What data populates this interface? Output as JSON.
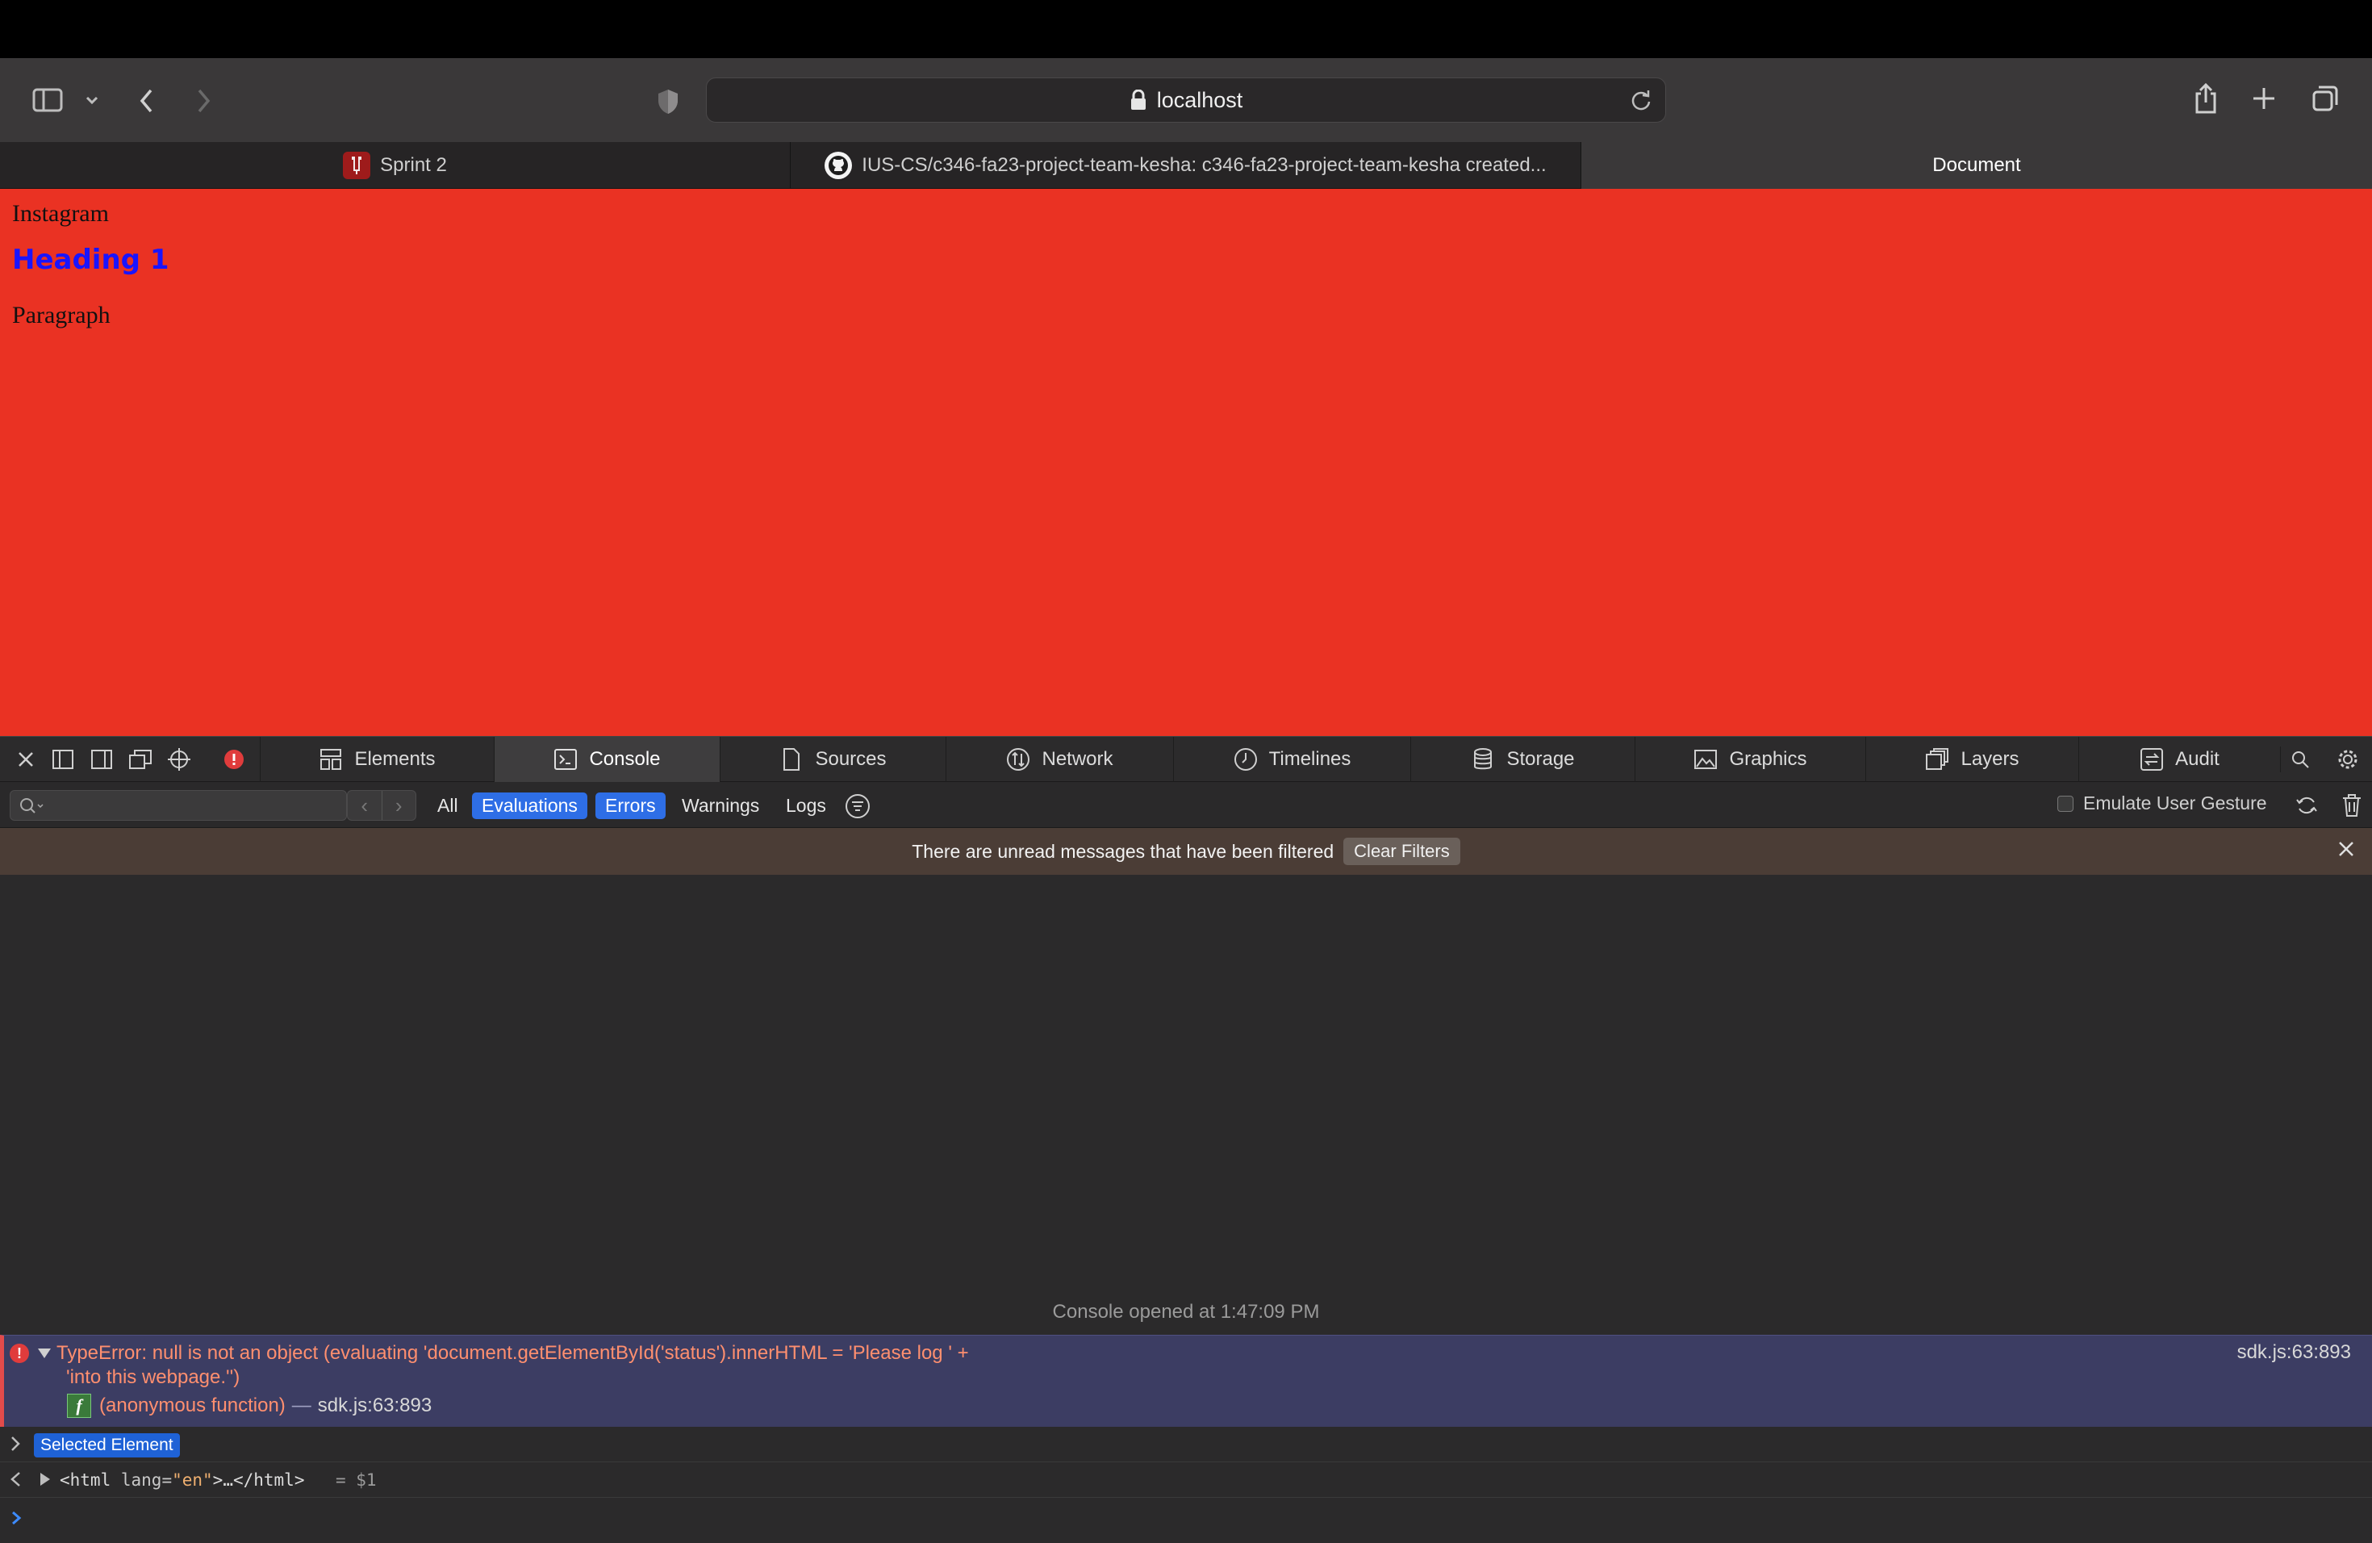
{
  "browser": {
    "address": "localhost",
    "tabs": [
      {
        "title": "Sprint 2",
        "active": false
      },
      {
        "title": "IUS-CS/c346-fa23-project-team-kesha: c346-fa23-project-team-kesha created...",
        "active": false
      },
      {
        "title": "Document",
        "active": true
      }
    ]
  },
  "page": {
    "brand": "Instagram",
    "heading": "Heading 1",
    "paragraph": "Paragraph",
    "background_color": "#ea3223",
    "heading_color": "#1a14ff"
  },
  "devtools": {
    "tabs": [
      {
        "label": "Elements",
        "icon": "elements-icon"
      },
      {
        "label": "Console",
        "icon": "console-icon",
        "active": true
      },
      {
        "label": "Sources",
        "icon": "sources-icon"
      },
      {
        "label": "Network",
        "icon": "network-icon"
      },
      {
        "label": "Timelines",
        "icon": "timelines-icon"
      },
      {
        "label": "Storage",
        "icon": "storage-icon"
      },
      {
        "label": "Graphics",
        "icon": "graphics-icon"
      },
      {
        "label": "Layers",
        "icon": "layers-icon"
      },
      {
        "label": "Audit",
        "icon": "audit-icon"
      }
    ],
    "filter": {
      "search_placeholder": "",
      "levels": [
        {
          "label": "All",
          "selected": false
        },
        {
          "label": "Evaluations",
          "selected": true
        },
        {
          "label": "Errors",
          "selected": true
        },
        {
          "label": "Warnings",
          "selected": false
        },
        {
          "label": "Logs",
          "selected": false
        }
      ],
      "emulate_label": "Emulate User Gesture"
    },
    "notice": {
      "text": "There are unread messages that have been filtered",
      "button": "Clear Filters"
    },
    "console": {
      "opened_text": "Console opened at 1:47:09 PM",
      "error": {
        "line1": "TypeError: null is not an object (evaluating 'document.getElementById('status').innerHTML = 'Please log ' +",
        "line2": "'into this webpage.'')",
        "source": "sdk.js:63:893",
        "frame_function": "(anonymous function)",
        "frame_separator": "—",
        "frame_location": "sdk.js:63:893"
      },
      "selected_element_label": "Selected Element",
      "html_open": "<html",
      "html_attr": "lang=",
      "html_attr_value": "\"en\"",
      "html_rest": ">…</html>",
      "html_ref": "= $1"
    }
  }
}
